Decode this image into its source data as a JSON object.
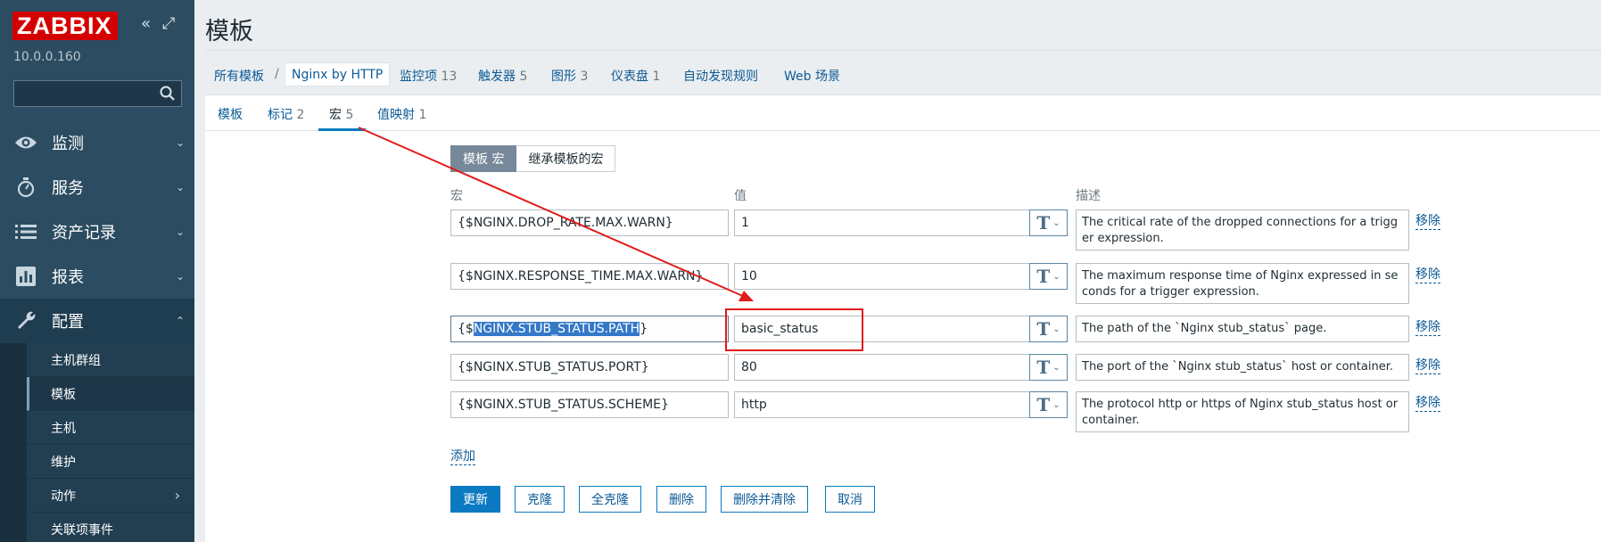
{
  "app": {
    "logo": "ZABBIX",
    "version": "10.0.0.160",
    "collapse_icon": "«",
    "expand_icon": "⤢",
    "search_placeholder": ""
  },
  "sidebar": {
    "menu": [
      {
        "label": "监测",
        "icon": "eye-icon",
        "caret": "⌄"
      },
      {
        "label": "服务",
        "icon": "stopwatch-icon",
        "caret": "⌄"
      },
      {
        "label": "资产记录",
        "icon": "list-icon",
        "caret": "⌄"
      },
      {
        "label": "报表",
        "icon": "bar-chart-icon",
        "caret": "⌄"
      },
      {
        "label": "配置",
        "icon": "wrench-icon",
        "caret": "⌃"
      }
    ],
    "submenu": [
      {
        "label": "主机群组"
      },
      {
        "label": "模板"
      },
      {
        "label": "主机"
      },
      {
        "label": "维护"
      },
      {
        "label": "动作",
        "caret": "›"
      },
      {
        "label": "关联项事件"
      }
    ]
  },
  "page": {
    "title": "模板"
  },
  "breadcrumb": {
    "all_templates": "所有模板",
    "separator": "/",
    "current": "Nginx by HTTP",
    "links": [
      {
        "label": "监控项",
        "count": "13"
      },
      {
        "label": "触发器",
        "count": "5"
      },
      {
        "label": "图形",
        "count": "3"
      },
      {
        "label": "仪表盘",
        "count": "1"
      },
      {
        "label": "自动发现规则",
        "count": ""
      },
      {
        "label": "Web 场景",
        "count": ""
      }
    ]
  },
  "tabs": [
    {
      "label": "模板",
      "count": ""
    },
    {
      "label": "标记",
      "count": "2"
    },
    {
      "label": "宏",
      "count": "5"
    },
    {
      "label": "值映射",
      "count": "1"
    }
  ],
  "macro_switch": {
    "template_macros": "模板 宏",
    "inherited_macros": "继承模板的宏"
  },
  "columns": {
    "macro": "宏",
    "value": "值",
    "description": "描述"
  },
  "macros": [
    {
      "macro": "{$NGINX.DROP_RATE.MAX.WARN}",
      "value": "1",
      "description": "The critical rate of the dropped connections for a trigger expression.",
      "remove": "移除"
    },
    {
      "macro": "{$NGINX.RESPONSE_TIME.MAX.WARN}",
      "value": "10",
      "description": "The maximum response time of Nginx expressed in seconds for a trigger expression.",
      "remove": "移除"
    },
    {
      "macro_prefix": "{$",
      "macro_selected": "NGINX.STUB_STATUS.PATH",
      "macro_suffix": "}",
      "value": "basic_status",
      "description": "The path of the `Nginx stub_status` page.",
      "remove": "移除"
    },
    {
      "macro": "{$NGINX.STUB_STATUS.PORT}",
      "value": "80",
      "description": "The port of the `Nginx stub_status` host or container.",
      "remove": "移除"
    },
    {
      "macro": "{$NGINX.STUB_STATUS.SCHEME}",
      "value": "http",
      "description": "The protocol http or https of Nginx stub_status host or container.",
      "remove": "移除"
    }
  ],
  "value_type_glyph": "T",
  "value_type_caret": "⌄",
  "add_label": "添加",
  "actions": {
    "update": "更新",
    "clone": "克隆",
    "full_clone": "全克隆",
    "delete": "删除",
    "delete_clear": "删除并清除",
    "cancel": "取消"
  },
  "colors": {
    "sidebar_bg": "#2b4c61",
    "logo_red": "#d40000",
    "link_blue": "#0b5a96",
    "primary_blue": "#0b7ac2",
    "annotation_red": "#e01b1b"
  }
}
